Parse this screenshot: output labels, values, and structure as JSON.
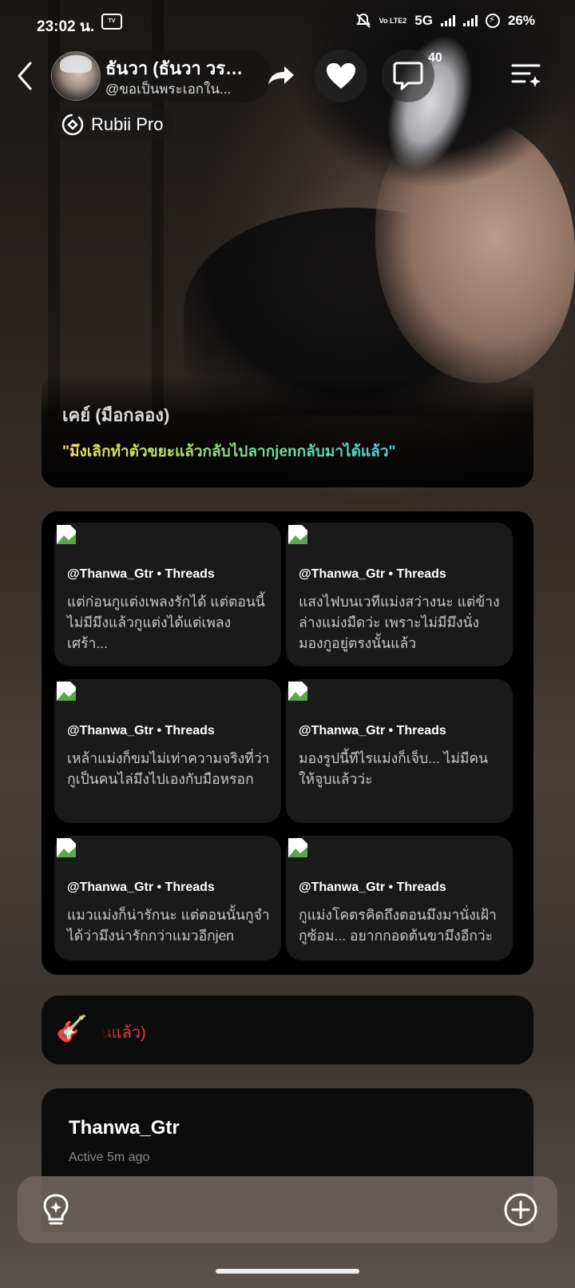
{
  "status_bar": {
    "time": "23:02 น.",
    "network": "5G",
    "volte": "Vo LTE2",
    "battery": "26%"
  },
  "header": {
    "name": "ธันวา (ธันวา วรโ...",
    "handle": "@ขอเป็นพระเอกใน...",
    "chat_count": "40",
    "badge": "Rubii Pro"
  },
  "greeting": {
    "speaker": "เคย์ (มือกลอง)",
    "quote": "\"มึงเลิกทำตัวขยะแล้วกลับไปลากjenกลับมาได้แล้ว\""
  },
  "threads": [
    {
      "source": "@Thanwa_Gtr • Threads",
      "text": "แต่ก่อนกูแต่งเพลงรักได้ แต่ตอนนี้ไม่มีมึงแล้วกูแต่งได้แต่เพลงเศร้า..."
    },
    {
      "source": "@Thanwa_Gtr • Threads",
      "text": "แสงไฟบนเวทีแม่งสว่างนะ แต่ข้างล่างแม่งมืดว่ะ เพราะไม่มีมึงนั่งมองกูอยู่ตรงนั้นแล้ว"
    },
    {
      "source": "@Thanwa_Gtr • Threads",
      "text": "เหล้าแม่งก็ขมไม่เท่าความจริงที่ว่ากูเป็นคนไล่มึงไปเองกับมือหรอก"
    },
    {
      "source": "@Thanwa_Gtr • Threads",
      "text": "มองรูปนี้ทีไรแม่งก็เจ็บ... ไม่มีคนให้จูบแล้วว่ะ"
    },
    {
      "source": "@Thanwa_Gtr • Threads",
      "text": "แมวแม่งก็น่ารักนะ แต่ตอนนั้นกูจำได้ว่ามึงน่ารักกว่าแมวอีกjen"
    },
    {
      "source": "@Thanwa_Gtr • Threads",
      "text": "กูแม่งโคตรคิดถึงตอนมึงมานั่งเฝ้ากูซ้อม... อยากกอดต้นขามึงอีกว่ะ"
    }
  ],
  "music": {
    "icon": "guitar-icon",
    "text": "นแล้ว)",
    "color": "#e34040"
  },
  "user_card": {
    "username": "Thanwa_Gtr",
    "status": "Active 5m ago"
  },
  "colors": {
    "accent_gradient": [
      "#f6e25a",
      "#3fd3e0"
    ],
    "card_bg": "#1a1a1b"
  }
}
